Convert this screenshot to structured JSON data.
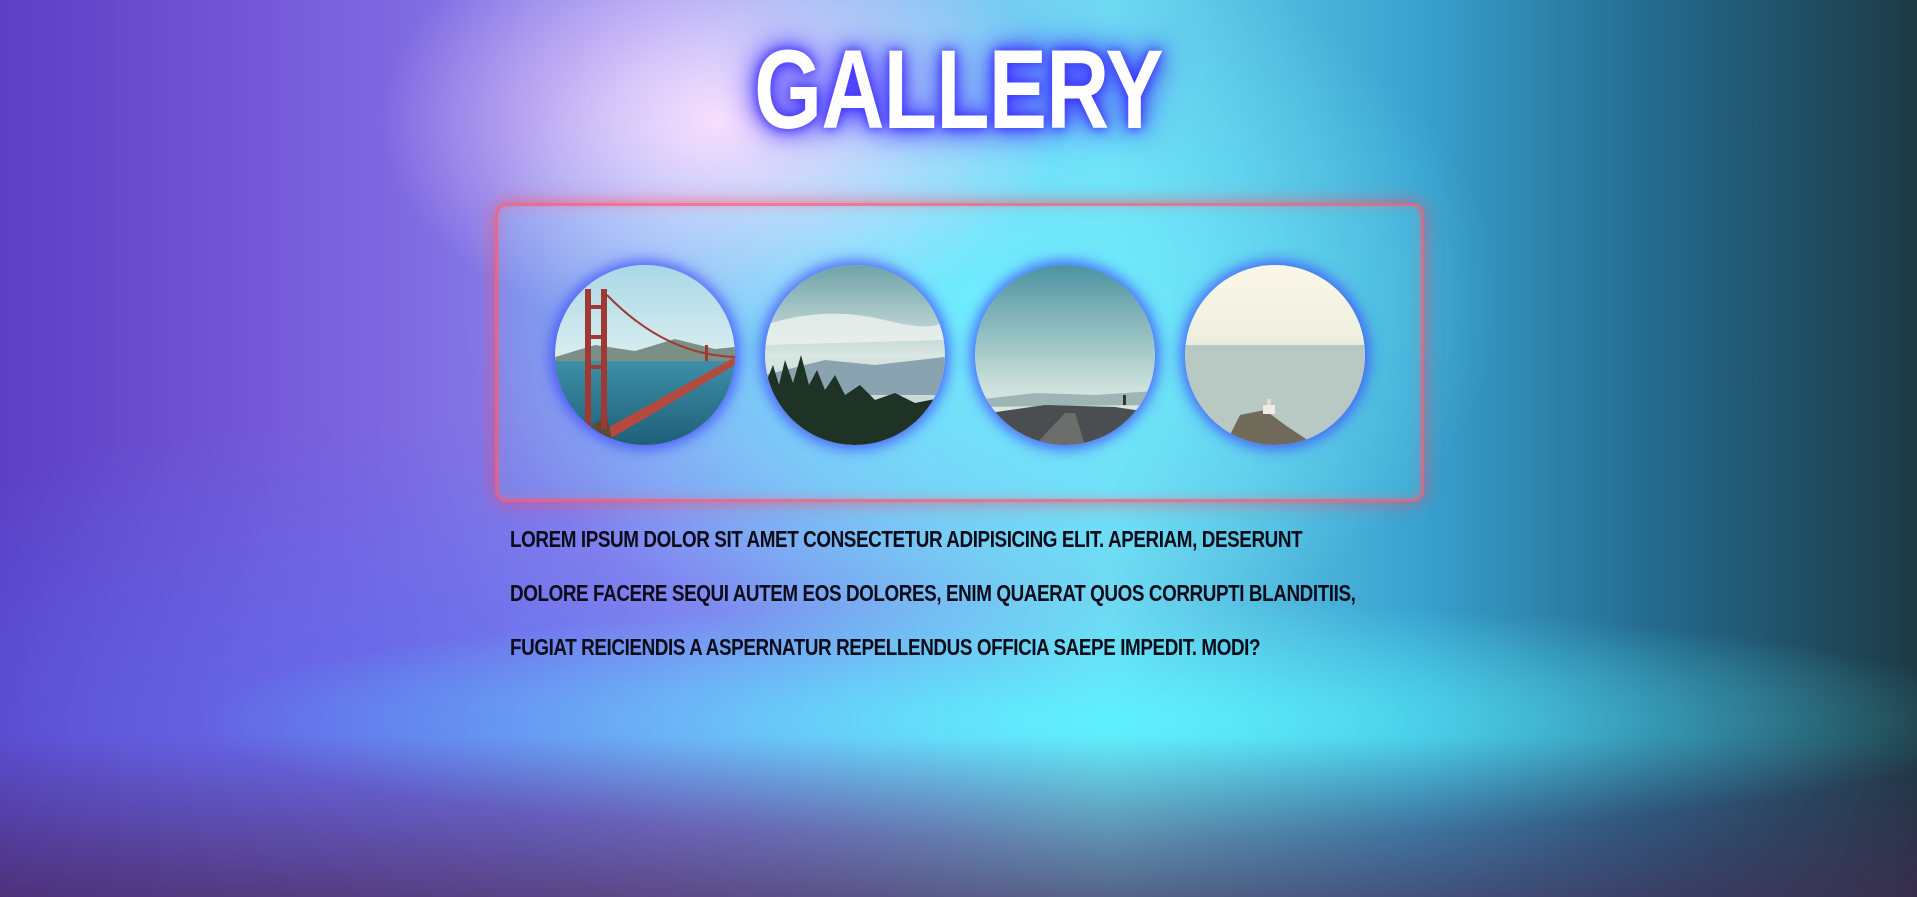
{
  "page": {
    "title": "GALLERY",
    "description": "Lorem ipsum dolor sit amet consectetur adipisicing elit. Aperiam, deserunt dolore facere sequi autem eos dolores, enim quaerat quos corrupti blanditiis, fugiat reiciendis a aspernatur repellendus officia saepe impedit. Modi?"
  },
  "gallery": {
    "images": [
      {
        "subject": "golden-gate-bridge"
      },
      {
        "subject": "forest-mountains"
      },
      {
        "subject": "coastal-road"
      },
      {
        "subject": "sea-cliff"
      }
    ]
  },
  "colors": {
    "title_glow": "#3a2cff",
    "box_border": "#ff5a6e",
    "thumb_glow": "#3c46ff",
    "text": "#0c0c1a"
  }
}
